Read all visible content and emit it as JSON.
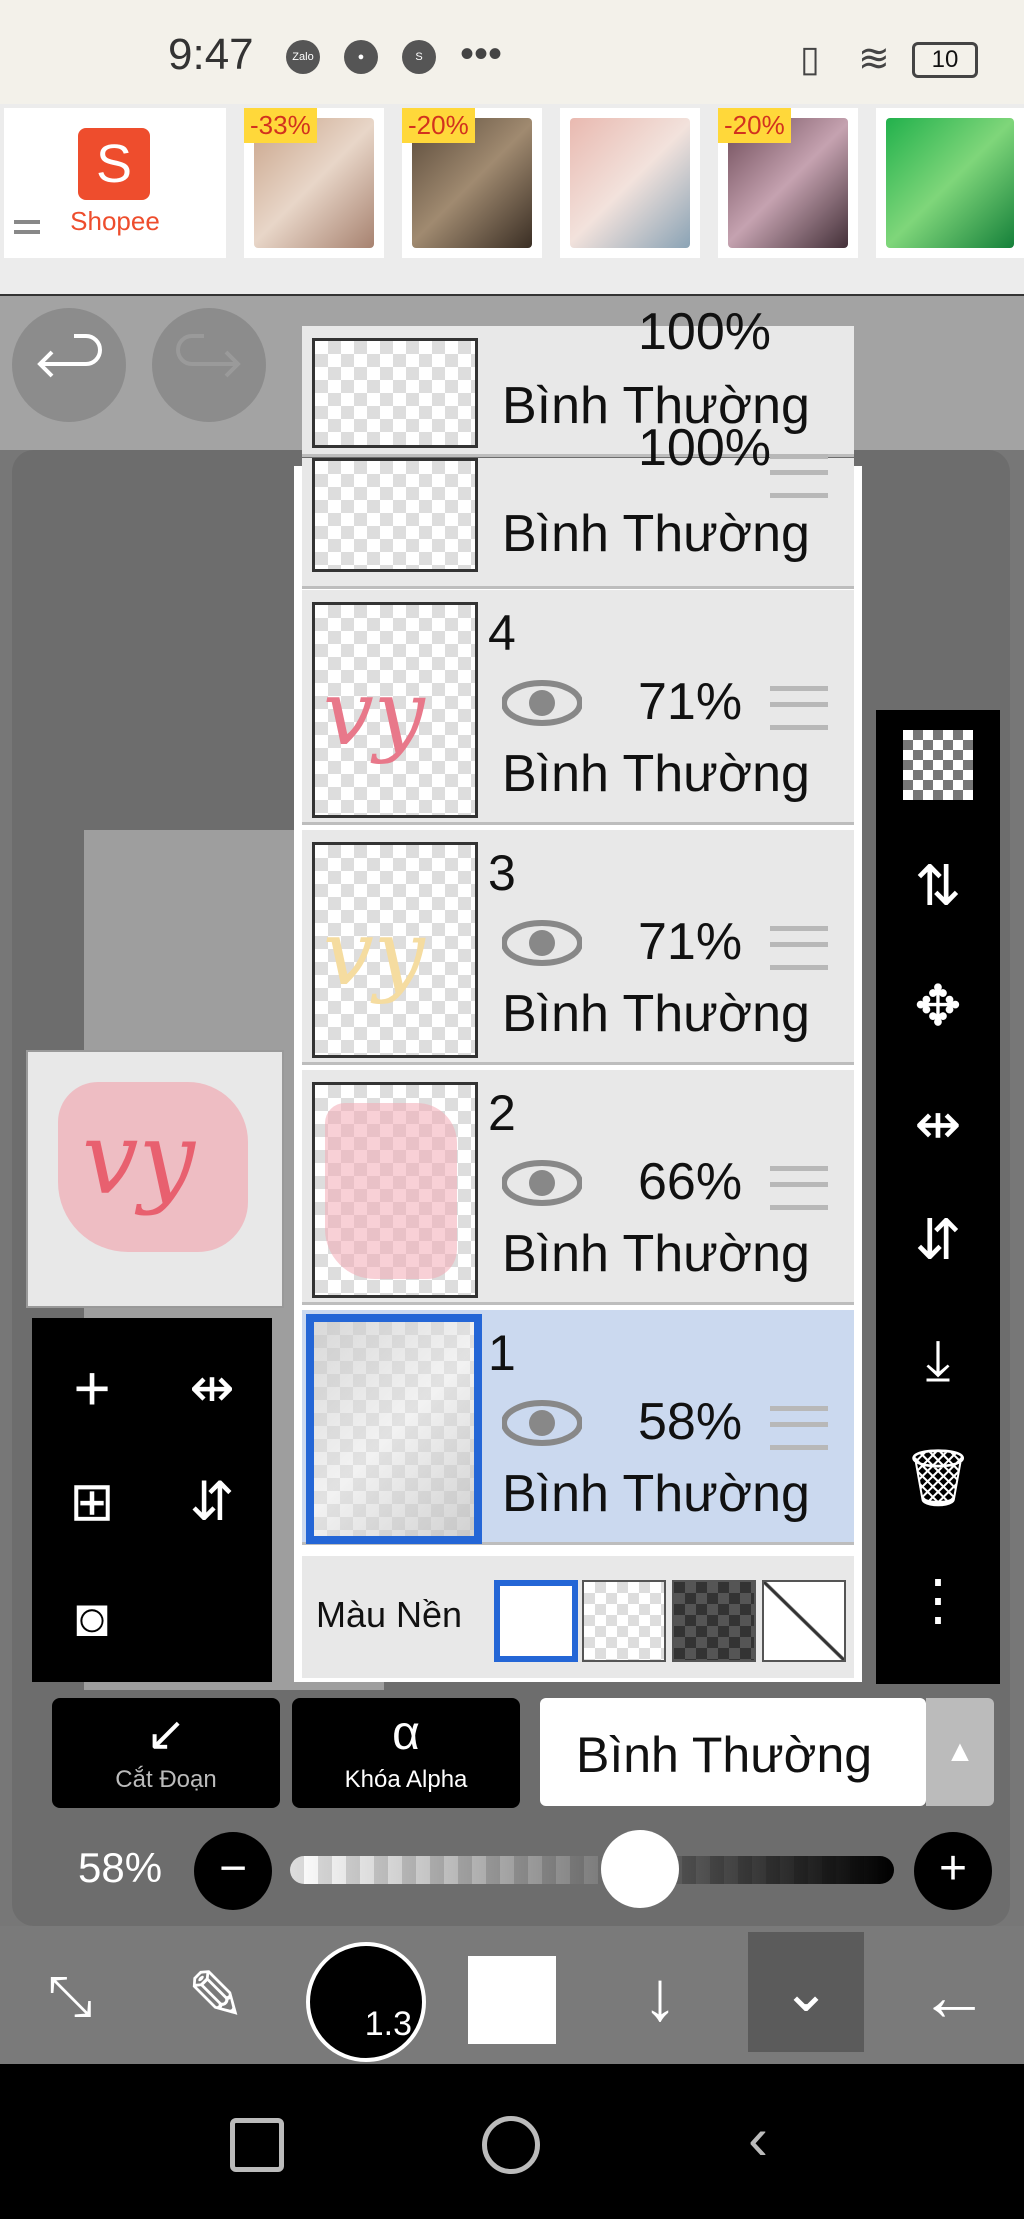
{
  "status_bar": {
    "time": "9:47",
    "app_icons": [
      "zalo-icon",
      "chat-icon",
      "shopee-bag-icon",
      "more-dots-icon"
    ],
    "battery_label": "10"
  },
  "ad_banner": {
    "brand": "Shopee",
    "tiles": [
      {
        "badge": "-33%"
      },
      {
        "badge": "-20%"
      },
      {
        "badge": ""
      },
      {
        "badge": "-20%"
      },
      {
        "badge": ""
      }
    ]
  },
  "toolbar_top": {
    "undo_icon": "undo-icon",
    "redo_icon": "redo-icon"
  },
  "layers": {
    "partial_top": {
      "opacity": "100%",
      "blend": "Bình Thường"
    },
    "items": [
      {
        "number": "4",
        "opacity": "71%",
        "blend": "Bình Thường"
      },
      {
        "number": "3",
        "opacity": "71%",
        "blend": "Bình Thường"
      },
      {
        "number": "2",
        "opacity": "66%",
        "blend": "Bình Thường"
      },
      {
        "number": "1",
        "opacity": "58%",
        "blend": "Bình Thường",
        "selected": true
      }
    ],
    "background_label": "Màu Nền"
  },
  "right_tools": [
    "transparency-icon",
    "swap-layers-icon",
    "move-icon",
    "flip-horizontal-icon",
    "flip-vertical-icon",
    "merge-down-icon",
    "delete-icon",
    "more-vertical-icon"
  ],
  "left_tools": [
    "add-layer-icon",
    "flip-h-icon",
    "add-copy-icon",
    "flip-v-icon",
    "camera-icon"
  ],
  "controls": {
    "clip_label": "Cắt Đoạn",
    "alpha_lock_label": "Khóa Alpha",
    "blend_mode": "Bình Thường",
    "opacity_label": "58%",
    "opacity_value": 0.58
  },
  "bottom_toolbar": {
    "brush_size": "1.3",
    "icons": [
      "transform-eraser-icon",
      "brush-icon",
      "brush-size-icon",
      "color-icon",
      "down-arrow-icon",
      "expand-icon",
      "back-arrow-icon"
    ]
  },
  "colors": {
    "selected_layer_bg": "#cbd9ef",
    "selected_border": "#2466d6",
    "shopee_orange": "#ee4d2d"
  }
}
